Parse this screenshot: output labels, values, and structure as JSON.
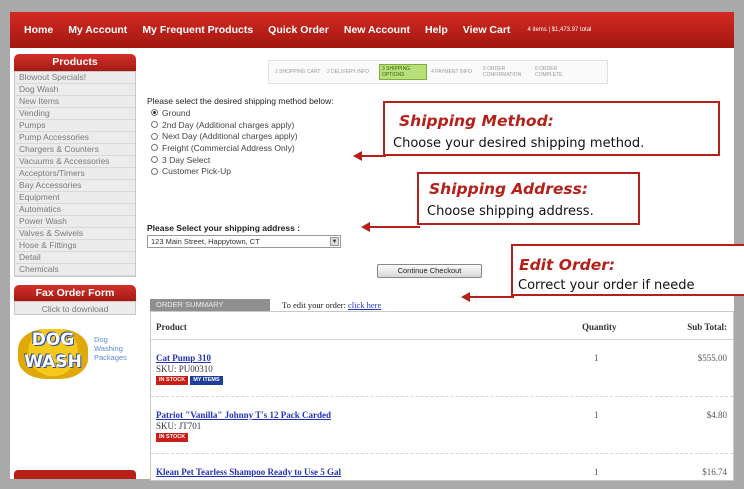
{
  "nav": {
    "items": [
      "Home",
      "My Account",
      "My Frequent Products",
      "Quick Order",
      "New Account",
      "Help",
      "View Cart"
    ],
    "phone": "4 items | $1,473.97 total"
  },
  "sidebar": {
    "title": "Products",
    "items": [
      "Blowout Specials!",
      "Dog Wash",
      "New Items",
      "Vending",
      "Pumps",
      "Pump Accessories",
      "Chargers & Counters",
      "Vacuums & Accessories",
      "Acceptors/Timers",
      "Bay Accessories",
      "Equipment",
      "Automatics",
      "Power Wash",
      "Valves & Swivels",
      "Hose & Fittings",
      "Detail",
      "Chemicals"
    ],
    "fax_title": "Fax Order Form",
    "fax_sub": "Click to download",
    "dogwash_logo": "DOG WASH",
    "dogwash_tag": "Dog Washing Packages"
  },
  "steps": [
    "1 SHOPPING CART",
    "2 DELIVERY INFO",
    "3 SHIPPING OPTIONS",
    "4 PAYMENT INFO",
    "5 ORDER CONFIRMATION",
    "6 ORDER COMPLETE"
  ],
  "shipping": {
    "title": "Please select the desired shipping method below:",
    "options": [
      "Ground",
      "2nd Day (Additional charges apply)",
      "Next Day (Additional charges apply)",
      "Freight (Commercial Address Only)",
      "3 Day Select",
      "Customer Pick-Up"
    ],
    "selected": 0
  },
  "address": {
    "title": "Please Select your shipping address :",
    "value": "123 Main Street, Happytown, CT"
  },
  "continue_label": "Continue Checkout",
  "summary": {
    "tab_label": "ORDER SUMMARY",
    "edit_text": "To edit your order:",
    "edit_link": "click here",
    "headers": [
      "Product",
      "Quantity",
      "Sub Total:"
    ],
    "rows": [
      {
        "name": "Cat Pump 310",
        "sku": "SKU: PU00310",
        "qty": "1",
        "sub": "$555.00",
        "badges": [
          "IN STOCK",
          "MY ITEMS"
        ]
      },
      {
        "name": "Patriot \"Vanilla\" Johnny T's 12 Pack Carded",
        "sku": "SKU: JT701",
        "qty": "1",
        "sub": "$4.80",
        "badges": [
          "IN STOCK"
        ]
      },
      {
        "name": "Klean Pet Tearless Shampoo Ready to Use 5 Gal",
        "sku": "",
        "qty": "1",
        "sub": "$16.74",
        "badges": []
      }
    ]
  },
  "callouts": {
    "method": {
      "title": "Shipping Method:",
      "text": "Choose your desired shipping method."
    },
    "address": {
      "title": "Shipping Address:",
      "text": "Choose shipping address."
    },
    "edit": {
      "title": "Edit Order:",
      "text": "Correct your order if neede"
    }
  },
  "colors": {
    "brand_red": "#b5211a",
    "nav_red": "#c8241d",
    "link_blue": "#2233bb"
  }
}
